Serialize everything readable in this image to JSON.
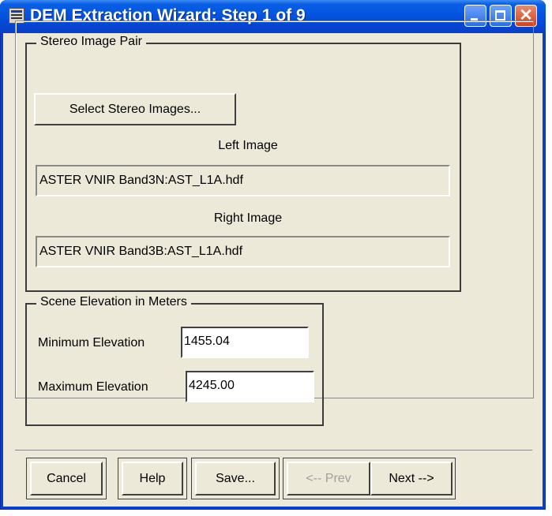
{
  "window": {
    "title": "DEM Extraction Wizard: Step 1 of 9"
  },
  "stereo_group": {
    "legend": "Stereo Image Pair",
    "select_button": "Select Stereo Images...",
    "left_caption": "Left Image",
    "left_value": "ASTER VNIR Band3N:AST_L1A.hdf",
    "right_caption": "Right Image",
    "right_value": "ASTER VNIR Band3B:AST_L1A.hdf"
  },
  "elevation_group": {
    "legend": "Scene Elevation in Meters",
    "min_label": "Minimum Elevation",
    "min_value": "1455.04",
    "max_label": "Maximum Elevation",
    "max_value": "4245.00"
  },
  "buttons": {
    "cancel": "Cancel",
    "help": "Help",
    "save": "Save...",
    "prev": "<-- Prev",
    "next": "Next -->"
  },
  "icons": {
    "app": "app-icon",
    "minimize": "minimize-icon",
    "maximize": "maximize-icon",
    "close": "close-icon"
  },
  "colors": {
    "titlebar": "#0456e0",
    "client_bg": "#ece9d8",
    "close_button": "#d4401c"
  }
}
